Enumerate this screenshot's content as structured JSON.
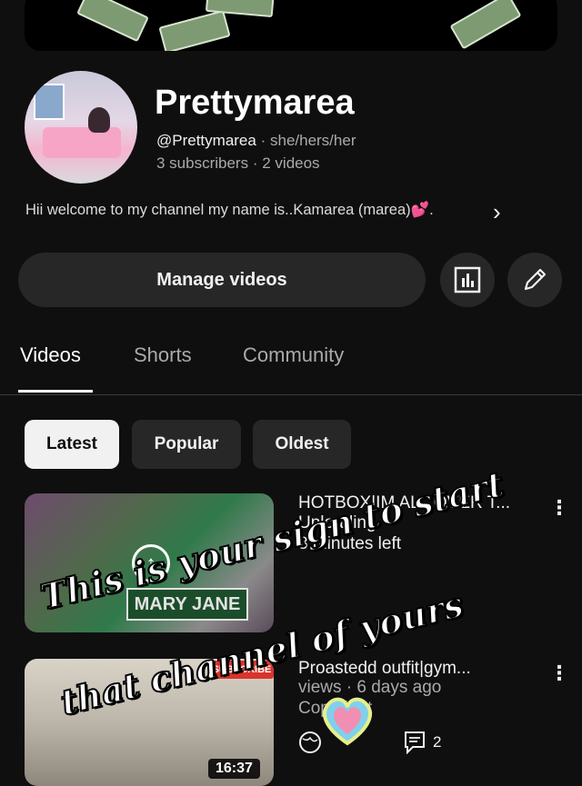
{
  "channel": {
    "name": "Prettymarea",
    "handle": "@Prettymarea",
    "pronouns": "she/hers/her",
    "subscribers": "3 subscribers",
    "videos": "2 videos",
    "description": "Hii welcome to my channel my name is..Kamarea (marea)💕."
  },
  "actions": {
    "manage_videos": "Manage videos",
    "analytics_icon": "analytics-icon",
    "edit_icon": "pencil-icon"
  },
  "tabs": [
    "Videos",
    "Shorts",
    "Community"
  ],
  "chips": [
    "Latest",
    "Popular",
    "Oldest"
  ],
  "videos": [
    {
      "title": "HOTBOX|IM ALL OVER T...",
      "status_line1": "Uploading",
      "status_line2": "8 minutes left",
      "thumb_sign": "MARY JANE"
    },
    {
      "title": "Proastedd outfit|gym...",
      "meta": "views · 6 days ago",
      "copyright": "Copyright",
      "comments": "2",
      "duration": "16:37",
      "thumb_badge": "SUBSCRIBE"
    }
  ],
  "overlay": {
    "line1": "This is your sign to start",
    "line2": "that channel of yours"
  },
  "colors": {
    "background": "#0f0f0f",
    "button": "#272727",
    "active_chip": "#f1f1f1"
  }
}
